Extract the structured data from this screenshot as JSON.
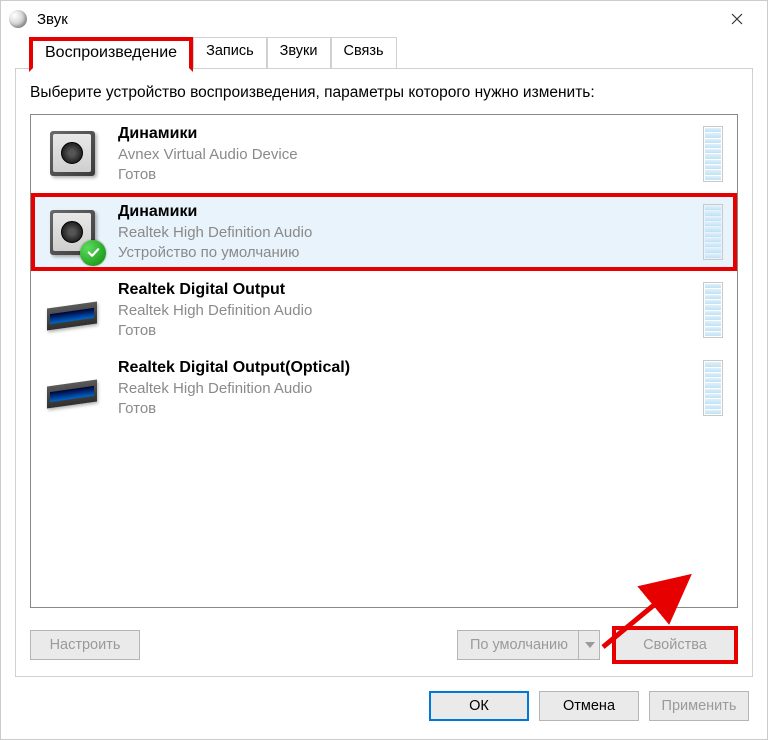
{
  "window": {
    "title": "Звук"
  },
  "tabs": {
    "items": [
      "Воспроизведение",
      "Запись",
      "Звуки",
      "Связь"
    ],
    "active_index": 0
  },
  "instruction": "Выберите устройство воспроизведения, параметры которого нужно изменить:",
  "devices": [
    {
      "name": "Динамики",
      "driver": "Avnex Virtual Audio Device",
      "status": "Готов",
      "kind": "speaker",
      "default": false,
      "selected": false
    },
    {
      "name": "Динамики",
      "driver": "Realtek High Definition Audio",
      "status": "Устройство по умолчанию",
      "kind": "speaker",
      "default": true,
      "selected": true
    },
    {
      "name": "Realtek Digital Output",
      "driver": "Realtek High Definition Audio",
      "status": "Готов",
      "kind": "digital",
      "default": false,
      "selected": false
    },
    {
      "name": "Realtek Digital Output(Optical)",
      "driver": "Realtek High Definition Audio",
      "status": "Готов",
      "kind": "digital",
      "default": false,
      "selected": false
    }
  ],
  "buttons": {
    "configure": "Настроить",
    "set_default": "По умолчанию",
    "properties": "Свойства",
    "ok": "ОК",
    "cancel": "Отмена",
    "apply": "Применить"
  },
  "annotations": {
    "highlight_tab": true,
    "highlight_device_index": 1,
    "highlight_properties": true,
    "arrow_to_properties": true
  },
  "colors": {
    "highlight": "#e60000",
    "selection_bg": "#e9f3fb",
    "primary": "#0078d7"
  }
}
